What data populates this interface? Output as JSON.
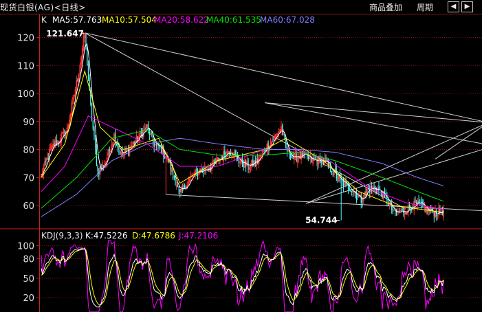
{
  "header": {
    "title": "现货白银(AG)<日线>",
    "menu_overlay": "商品叠加",
    "menu_period": "周期",
    "nav_prev": "◀",
    "nav_next": "▶"
  },
  "ma_legend": {
    "k": "K",
    "ma5": "MA5:57.763",
    "ma10": "MA10:57.504",
    "ma20": "MA20:58.622",
    "ma40": "MA40:61.535",
    "ma60": "MA60:67.028"
  },
  "kdj_legend": {
    "name": "KDJ(9,3,3)",
    "k": "K:47.5226",
    "d": "D:47.6786",
    "j": "J:47.2106"
  },
  "colors": {
    "up": "#ff3232",
    "down": "#54ffff",
    "ma5": "#ffffff",
    "ma10": "#ffff00",
    "ma20": "#ff00ff",
    "ma40": "#00e600",
    "ma60": "#8080ff",
    "grid": "#7a1010",
    "axis": "#c82020",
    "kdj_k": "#ffffff",
    "kdj_d": "#ffff00",
    "kdj_j": "#ff00ff"
  },
  "chart_data": [
    {
      "type": "candlestick",
      "title": "现货白银(AG)<日线>",
      "yticks": [
        120,
        110,
        100,
        90,
        80,
        70,
        60
      ],
      "ylim": [
        52.4,
        124.8
      ],
      "grid": true,
      "annotations": [
        {
          "label": "121.647",
          "value": 121.647,
          "bar": 37
        },
        {
          "label": "54.744",
          "value": 54.744,
          "bar": 255
        }
      ],
      "trend_lines": [
        [
          [
            37,
            121.65
          ],
          [
            380,
            89.6
          ]
        ],
        [
          [
            37,
            121.65
          ],
          [
            310,
            58.7
          ]
        ],
        [
          [
            380,
            89.6
          ],
          [
            335,
            76.6
          ]
        ],
        [
          [
            380,
            89.6
          ],
          [
            645,
            52.4
          ]
        ],
        [
          [
            380,
            89.6
          ],
          [
            645,
            60.7
          ]
        ],
        [
          [
            380,
            89.6
          ],
          [
            645,
            81.2
          ]
        ],
        [
          [
            190,
            96.7
          ],
          [
            380,
            89.6
          ]
        ],
        [
          [
            190,
            96.7
          ],
          [
            645,
            60.7
          ]
        ],
        [
          [
            225,
            60.7
          ],
          [
            380,
            89.6
          ]
        ],
        [
          [
            225,
            60.7
          ],
          [
            645,
            114.7
          ]
        ],
        [
          [
            106,
            63.9
          ],
          [
            645,
            52.4
          ]
        ]
      ],
      "anchors": [
        [
          0,
          70.6
        ],
        [
          8,
          80.0
        ],
        [
          22,
          87.0
        ],
        [
          32,
          108.0
        ],
        [
          37,
          121.6
        ],
        [
          42,
          95.0
        ],
        [
          48,
          72.0
        ],
        [
          55,
          76.0
        ],
        [
          62,
          85.0
        ],
        [
          68,
          78.0
        ],
        [
          74,
          80.0
        ],
        [
          82,
          84.0
        ],
        [
          90,
          88.0
        ],
        [
          96,
          82.0
        ],
        [
          102,
          80.0
        ],
        [
          108,
          76.0
        ],
        [
          113,
          70.0
        ],
        [
          118,
          64.0
        ],
        [
          124,
          68.0
        ],
        [
          132,
          72.0
        ],
        [
          140,
          73.0
        ],
        [
          150,
          76.0
        ],
        [
          160,
          80.0
        ],
        [
          168,
          76.0
        ],
        [
          176,
          74.0
        ],
        [
          184,
          76.0
        ],
        [
          190,
          80.0
        ],
        [
          198,
          84.0
        ],
        [
          204,
          88.0
        ],
        [
          208,
          80.0
        ],
        [
          214,
          77.0
        ],
        [
          222,
          78.0
        ],
        [
          230,
          76.0
        ],
        [
          240,
          76.0
        ],
        [
          248,
          72.0
        ],
        [
          256,
          68.0
        ],
        [
          264,
          66.0
        ],
        [
          272,
          62.0
        ],
        [
          278,
          66.0
        ],
        [
          286,
          66.0
        ],
        [
          294,
          62.0
        ],
        [
          300,
          57.0
        ],
        [
          308,
          58.0
        ],
        [
          316,
          60.0
        ],
        [
          322,
          60.0
        ],
        [
          330,
          58.0
        ],
        [
          336,
          57.5
        ],
        [
          342,
          58.0
        ]
      ],
      "ma_anchors": {
        "ma10": [
          [
            0,
            70
          ],
          [
            20,
            82
          ],
          [
            37,
            108
          ],
          [
            50,
            88
          ],
          [
            70,
            80
          ],
          [
            100,
            84
          ],
          [
            118,
            68
          ],
          [
            150,
            76
          ],
          [
            190,
            80
          ],
          [
            208,
            84
          ],
          [
            240,
            76
          ],
          [
            270,
            65
          ],
          [
            300,
            60
          ],
          [
            342,
            57.5
          ]
        ],
        "ma20": [
          [
            0,
            65
          ],
          [
            20,
            74
          ],
          [
            40,
            92
          ],
          [
            60,
            88
          ],
          [
            90,
            82
          ],
          [
            118,
            74
          ],
          [
            150,
            74
          ],
          [
            190,
            80
          ],
          [
            215,
            80
          ],
          [
            245,
            76
          ],
          [
            280,
            66
          ],
          [
            310,
            61
          ],
          [
            342,
            58.6
          ]
        ],
        "ma40": [
          [
            0,
            59
          ],
          [
            30,
            70
          ],
          [
            60,
            84
          ],
          [
            90,
            87
          ],
          [
            118,
            80
          ],
          [
            150,
            78
          ],
          [
            190,
            78
          ],
          [
            220,
            79
          ],
          [
            250,
            76
          ],
          [
            290,
            70
          ],
          [
            320,
            65
          ],
          [
            342,
            61.5
          ]
        ],
        "ma60": [
          [
            0,
            56
          ],
          [
            30,
            64
          ],
          [
            60,
            76
          ],
          [
            90,
            82
          ],
          [
            118,
            84
          ],
          [
            150,
            82
          ],
          [
            190,
            80
          ],
          [
            220,
            80
          ],
          [
            250,
            79
          ],
          [
            290,
            75
          ],
          [
            320,
            70
          ],
          [
            342,
            67.0
          ]
        ]
      }
    },
    {
      "type": "line",
      "title": "KDJ(9,3,3)",
      "yticks": [
        100,
        80,
        50,
        20
      ],
      "ylim": [
        0,
        106
      ],
      "grid": true,
      "series": [
        {
          "name": "K",
          "values": [
            47.5226
          ]
        },
        {
          "name": "D",
          "values": [
            47.6786
          ]
        },
        {
          "name": "J",
          "values": [
            47.2106
          ]
        }
      ]
    }
  ]
}
